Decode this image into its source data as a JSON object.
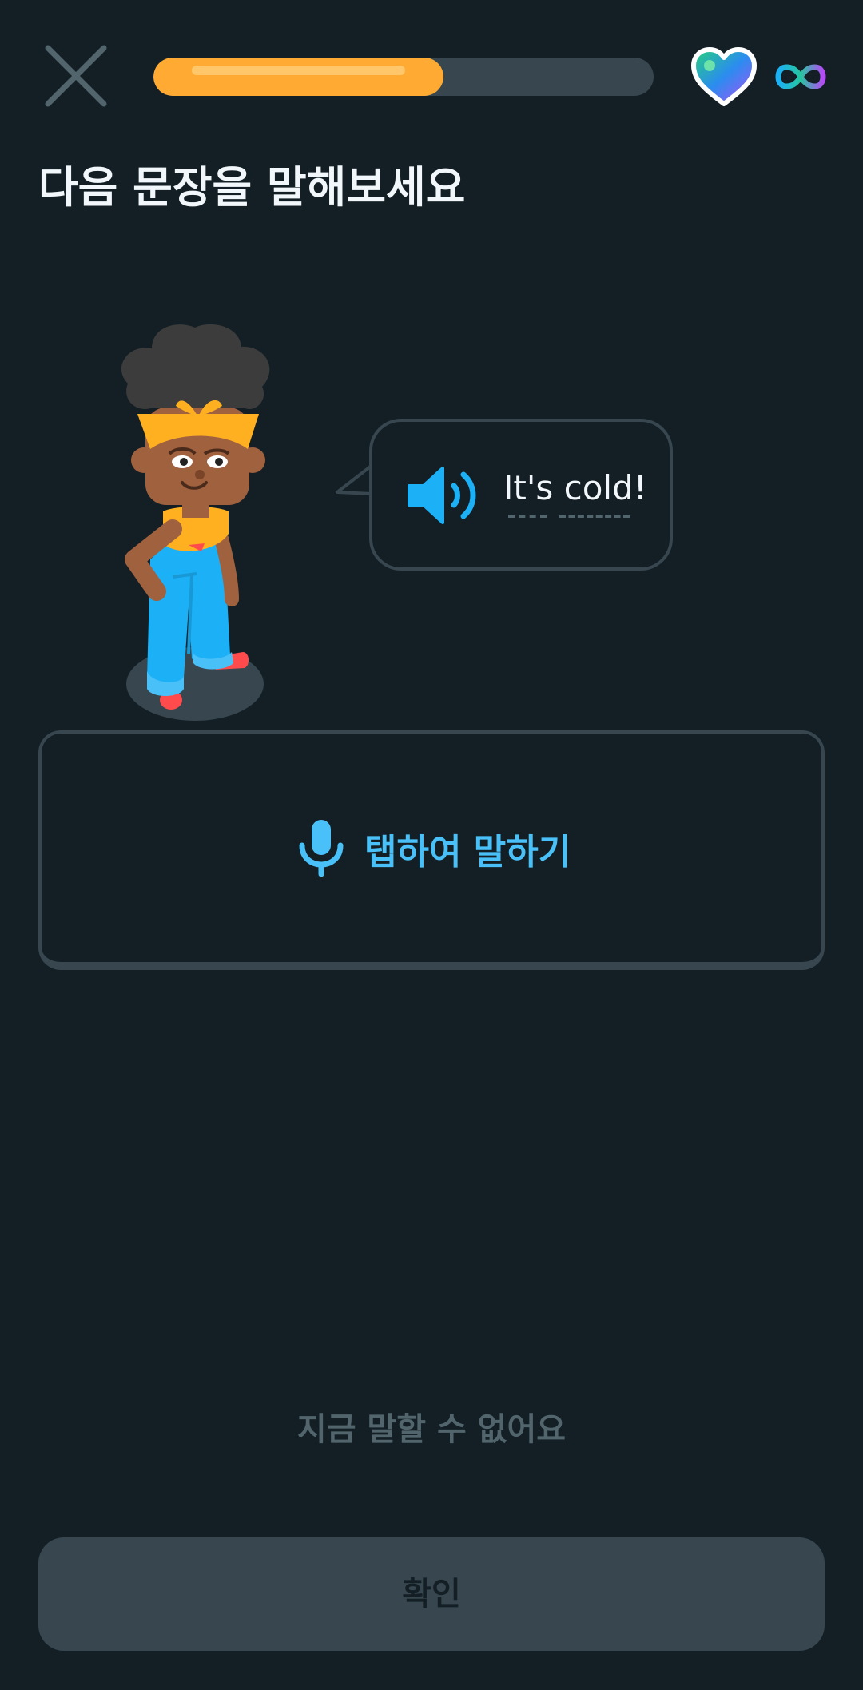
{
  "header": {
    "close_icon": "close-icon",
    "progress": 0.58,
    "progress_color": "#ffab33",
    "track_color": "#37464f",
    "hearts_icon": "heart-icon",
    "hearts_value_icon": "infinity-icon"
  },
  "exercise": {
    "title": "다음 문장을 말해보세요",
    "phrase": "It's cold!",
    "speaker_icon": "speaker-icon"
  },
  "speak_button": {
    "icon": "microphone-icon",
    "label": "탭하여 말하기",
    "color": "#49c0f8"
  },
  "footer": {
    "cant_speak_label": "지금 말할 수 없어요",
    "check_label": "확인"
  },
  "colors": {
    "background": "#131f24",
    "border": "#37464f",
    "muted_text": "#52656d"
  }
}
